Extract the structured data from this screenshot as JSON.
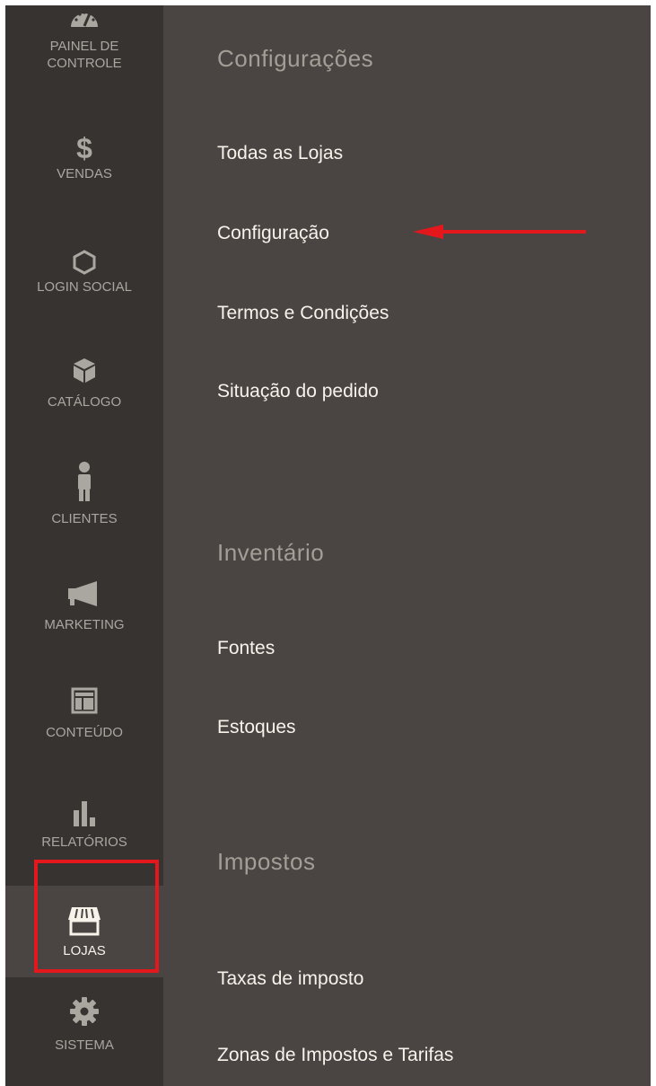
{
  "sidebar": {
    "items": [
      {
        "label": "PAINEL DE CONTROLE",
        "icon": "dashboard-gauge-icon"
      },
      {
        "label": "VENDAS",
        "icon": "dollar-icon"
      },
      {
        "label": "LOGIN SOCIAL",
        "icon": "hexagon-icon"
      },
      {
        "label": "CATÁLOGO",
        "icon": "box-icon"
      },
      {
        "label": "CLIENTES",
        "icon": "person-icon"
      },
      {
        "label": "MARKETING",
        "icon": "megaphone-icon"
      },
      {
        "label": "CONTEÚDO",
        "icon": "layout-icon"
      },
      {
        "label": "RELATÓRIOS",
        "icon": "bar-chart-icon"
      },
      {
        "label": "LOJAS",
        "icon": "store-icon"
      },
      {
        "label": "SISTEMA",
        "icon": "gear-icon"
      }
    ],
    "active": "LOJAS"
  },
  "menu": {
    "sections": [
      {
        "title": "Configurações",
        "links": [
          "Todas as Lojas",
          "Configuração",
          "Termos e Condições",
          "Situação do pedido"
        ]
      },
      {
        "title": "Inventário",
        "links": [
          "Fontes",
          "Estoques"
        ]
      },
      {
        "title": "Impostos",
        "links": [
          "Taxas de imposto",
          "Zonas de Impostos e Tarifas"
        ]
      }
    ]
  },
  "colors": {
    "sidebar_bg": "#373330",
    "panel_bg": "#4a4542",
    "highlight": "#e3171c",
    "section_title": "#a39e96",
    "link_text": "#f7f3eb"
  }
}
